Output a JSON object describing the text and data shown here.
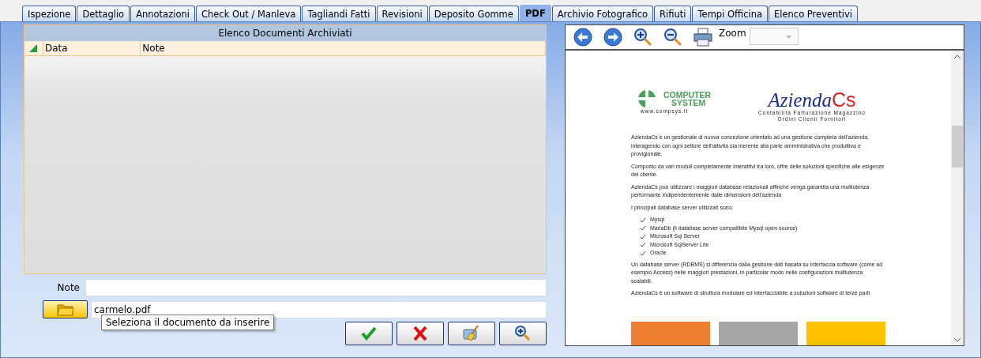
{
  "tabs": [
    {
      "label": "Ispezione",
      "selected": false
    },
    {
      "label": "Dettaglio",
      "selected": false
    },
    {
      "label": "Annotazioni",
      "selected": false
    },
    {
      "label": "Check Out / Manleva",
      "selected": false
    },
    {
      "label": "Tagliandi Fatti",
      "selected": false
    },
    {
      "label": "Revisioni",
      "selected": false
    },
    {
      "label": "Deposito Gomme",
      "selected": false
    },
    {
      "label": "PDF",
      "selected": true
    },
    {
      "label": "Archivio Fotografico",
      "selected": false
    },
    {
      "label": "Rifiuti",
      "selected": false
    },
    {
      "label": "Tempi Officina",
      "selected": false
    },
    {
      "label": "Elenco Preventivi",
      "selected": false
    }
  ],
  "documents": {
    "title": "Elenco Documenti Archiviati",
    "sort_indicator": true,
    "columns": [
      "Data",
      "Note"
    ]
  },
  "note": {
    "label": "Note"
  },
  "file": {
    "value": "carmelo.pdf"
  },
  "tooltip": "Seleziona il documento da inserire",
  "viewer": {
    "zoom": {
      "label": "Zoom",
      "disabled": true
    },
    "document": {
      "logo_left": {
        "line_1": "COMPUTER",
        "line_2": "SYSTEM",
        "url": "www.compsys.it"
      },
      "logo_right": {
        "name": "Azienda",
        "suffix": "Cs",
        "line_1": "Contabilità Fatturazione Magazzino",
        "line_2": "Ordini Clienti Fornitori"
      },
      "blocks": [
        {
          "kind": "para",
          "text": "AziendaCs è un gestionale di nuova concezione orientato ad una gestione completa dell'azienda, interagendo con ogni settore dell'attività sia inerente alla parte amministrativa che produttiva e provigionale."
        },
        {
          "kind": "para",
          "text": "Composto da vari moduli completamente interattivi tra loro, offre delle soluzioni specifiche alle esigenze del cliente."
        },
        {
          "kind": "para",
          "text": "AziendaCs può utilizzare i maggiori database relazionali affinché venga garantita una multiutenza performante indipendentemente dalle dimensioni dell'azienda"
        },
        {
          "kind": "para",
          "text": "I principali database server utilizzati sono:"
        },
        {
          "kind": "list",
          "items": [
            "Mysql",
            "MariaDb (il database server compatibile Mysql open source)",
            "Microsoft Sql Server",
            "Microsoft SqlServer Lite",
            "Oracle"
          ]
        },
        {
          "kind": "para",
          "text": "Un database server (RDBMS) si differenzia dalla gestione dati basata su interfaccia software (come ad esempio Access) nelle maggiori prestazioni, in particolar modo nelle configurazioni multiutenza scalabili."
        },
        {
          "kind": "para",
          "text": "AziendaCs è un software di struttura modulare ed interfacciabile a soluzioni software di terze parti"
        }
      ],
      "color_blocks": [
        {
          "color": "#ed7d31"
        },
        {
          "color": "#a5a5a5"
        },
        {
          "color": "#ffc000"
        }
      ]
    }
  }
}
